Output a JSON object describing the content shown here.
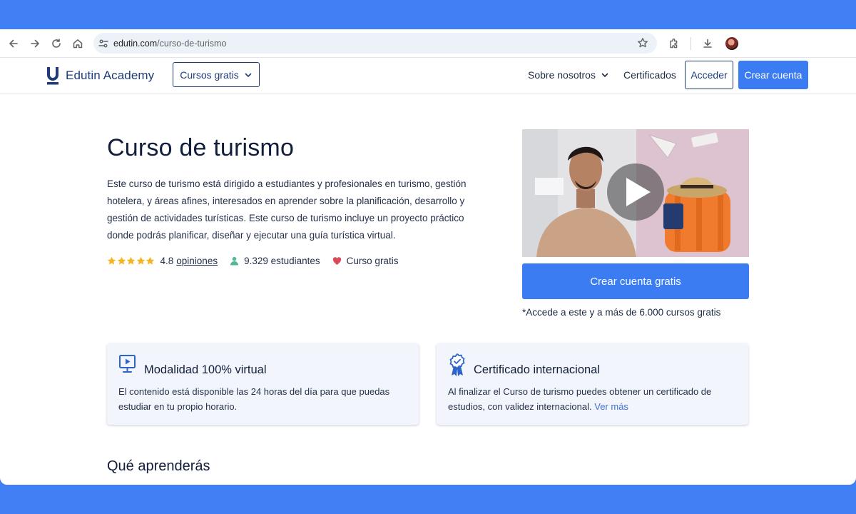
{
  "browser": {
    "url_domain": "edutin.com",
    "url_path": "/curso-de-turismo"
  },
  "header": {
    "brand": "Edutin Academy",
    "cursos_label": "Cursos gratis",
    "sobre_label": "Sobre nosotros",
    "certificados_label": "Certificados",
    "acceder_label": "Acceder",
    "crear_cuenta_label": "Crear cuenta"
  },
  "hero": {
    "title": "Curso de turismo",
    "description": "Este curso de turismo está dirigido a estudiantes y profesionales en turismo, gestión hotelera, y áreas afines, interesados en aprender sobre la planificación, desarrollo y gestión de actividades turísticas. Este curso de turismo incluye un proyecto práctico donde podrás planificar, diseñar y ejecutar una guía turística virtual.",
    "rating": "4.8",
    "rating_stars": 5,
    "opiniones_label": "opiniones",
    "students": "9.329 estudiantes",
    "free_label": "Curso gratis",
    "cta_label": "Crear cuenta gratis",
    "cta_note": "*Accede a este y a más de 6.000 cursos gratis"
  },
  "features": [
    {
      "title": "Modalidad 100% virtual",
      "text": "El contenido está disponible las 24 horas del día para que puedas estudiar en tu propio horario.",
      "icon": "monitor-play-icon"
    },
    {
      "title": "Certificado internacional",
      "text": "Al finalizar el Curso de turismo puedes obtener un certificado de estudios, con validez internacional.",
      "link": "Ver más",
      "icon": "award-ribbon-icon"
    }
  ],
  "section": {
    "aprenderas": "Qué aprenderás"
  },
  "colors": {
    "accent": "#3b7cf2",
    "navy": "#1d3c78",
    "frame": "#4080f4",
    "star": "#f5b523",
    "heart": "#d94a5a",
    "students_icon": "#52b891"
  }
}
